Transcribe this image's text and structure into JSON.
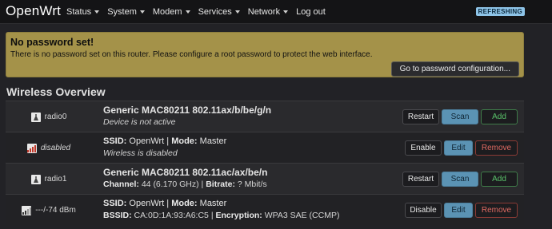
{
  "brand": "OpenWrt",
  "menu": [
    "Status",
    "System",
    "Modem",
    "Services",
    "Network",
    "Log out"
  ],
  "badge": "REFRESHING",
  "alert": {
    "title": "No password set!",
    "text": "There is no password set on this router. Please configure a root password to protect the web interface.",
    "button": "Go to password configuration..."
  },
  "section_title": "Wireless Overview",
  "rows": [
    {
      "status_label": "radio0",
      "line1": "Generic MAC80211 802.11ax/b/be/g/n",
      "line2": "Device is not active",
      "buttons": [
        "Restart",
        "Scan",
        "Add"
      ]
    },
    {
      "status_label": "disabled",
      "ssid_key": "SSID:",
      "ssid": "OpenWrt",
      "mode_key": "Mode:",
      "mode": "Master",
      "line2": "Wireless is disabled",
      "buttons": [
        "Enable",
        "Edit",
        "Remove"
      ]
    },
    {
      "status_label": "radio1",
      "line1": "Generic MAC80211 802.11ac/ax/be/n",
      "channel_key": "Channel:",
      "channel": "44 (6.170 GHz)",
      "bitrate_key": "Bitrate:",
      "bitrate": "? Mbit/s",
      "buttons": [
        "Restart",
        "Scan",
        "Add"
      ]
    },
    {
      "status_label": "---/-74 dBm",
      "ssid_key": "SSID:",
      "ssid": "OpenWrt",
      "mode_key": "Mode:",
      "mode": "Master",
      "bssid_key": "BSSID:",
      "bssid": "CA:0D:1A:93:A6:C5",
      "encryption_key": "Encryption:",
      "encryption": "WPA3 SAE (CCMP)",
      "buttons": [
        "Disable",
        "Edit",
        "Remove"
      ]
    }
  ],
  "colors": {
    "accent": "#5b93b4",
    "alert_bg": "#a49249",
    "add": "#59c069",
    "remove": "#e06a62"
  },
  "icons": [
    "radio-device-icon",
    "signal-disabled-icon",
    "radio-device-icon",
    "signal-bars-icon"
  ]
}
